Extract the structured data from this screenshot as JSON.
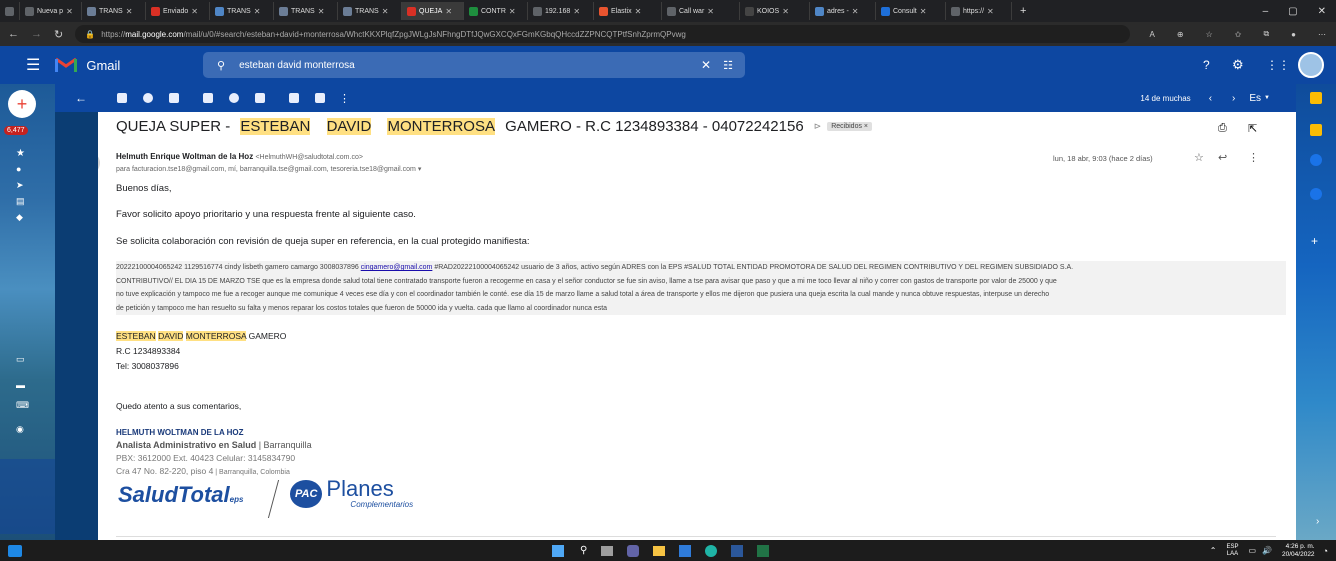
{
  "browser": {
    "tabs": [
      {
        "label": "Nueva p"
      },
      {
        "label": "TRANS"
      },
      {
        "label": "Enviado"
      },
      {
        "label": "TRANS"
      },
      {
        "label": "TRANS"
      },
      {
        "label": "TRANS"
      },
      {
        "label": "QUEJA"
      },
      {
        "label": "CONTR"
      },
      {
        "label": "192.168"
      },
      {
        "label": "Elastix"
      },
      {
        "label": "Call war"
      },
      {
        "label": "KOIOS"
      },
      {
        "label": "adres -"
      },
      {
        "label": "Consult"
      },
      {
        "label": "https://"
      }
    ],
    "url_prefix": "https://",
    "url_host": "mail.google.com",
    "url_rest": "/mail/u/0/#search/esteban+david+monterrosa/WhctKKXPlqfZpgJWLgJsNFhngDTfJQwGXCQxFGmKGbqQHccdZZPNCQTPtfSnhZprmQPvwg"
  },
  "gmail": {
    "brand": "Gmail",
    "search_value": "esteban david monterrosa",
    "unread_count": "6,477",
    "pager": "14 de muchas",
    "lang": "Es"
  },
  "email": {
    "subject_prefix": "QUEJA SUPER - ",
    "subject_name1": "ESTEBAN",
    "subject_name2": "DAVID",
    "subject_name3": "MONTERROSA",
    "subject_suffix": " GAMERO - R.C 1234893384 - 04072242156",
    "label": "Recibidos ×",
    "sender_name": "Helmuth Enrique Woltman de la Hoz",
    "sender_email": "<HelmuthWH@saludtotal.com.co>",
    "recipients": "para facturacion.tse18@gmail.com, mí, barranquilla.tse@gmail.com, tesoreria.tse18@gmail.com",
    "date": "lun, 18 abr, 9:03 (hace 2 días)",
    "greeting": "Buenos días,",
    "line1": "Favor solicito apoyo prioritario y una respuesta frente al siguiente caso.",
    "line2": "Se solicita colaboración con revisión de queja super en referencia, en la cual protegido manifiesta:",
    "quote1a": "20222100004065242 1129516774 cindy lisbeth gamero camargo 3008037896 ",
    "quote1_link": "cingamero@gmail.com",
    "quote1b": " #RAD20222100004065242 usuario de 3 años, activo según ADRES con la EPS #SALUD TOTAL ENTIDAD PROMOTORA DE SALUD DEL REGIMEN CONTRIBUTIVO Y DEL REGIMEN SUBSIDIADO S.A.",
    "quote2": "CONTRIBUTIVO// EL DIA 15 DE MARZO TSE que es la empresa donde salud total tiene contratado transporte fueron a recogerme en casa y el señor conductor se fue sin aviso, llame a tse para avisar que paso y que a mi me toco llevar al niño y correr con gastos de transporte por valor de 25000 y que",
    "quote3": "no tuve explicación y tampoco me fue a recoger aunque me comunique 4 veces ese día y con el coordinador también le conté. ese día 15 de marzo llame a salud total a área de transporte y ellos me dijeron que pusiera una queja escrita la cual mande y nunca obtuve respuestas, interpuse un derecho",
    "quote4": "de petición y tampoco me han resuelto su falta y menos reparar los costos totales que fueron de 50000 ida y vuelta. cada que llamo al coordinador nunca esta",
    "name_line_suffix": " GAMERO",
    "rc": "R.C 1234893384",
    "tel": "Tel: 3008037896",
    "closing": "Quedo atento a sus comentarios,",
    "sig_name": "HELMUTH WOLTMAN DE LA HOZ",
    "sig_title": "Analista Administrativo en Salud",
    "sig_city": " | Barranquilla",
    "sig_phone": "PBX: 3612000 Ext. 40423 Celular: 3145834790",
    "sig_addr": "Cra 47 No. 82-220, piso 4",
    "sig_addr_city": " | Barranquilla, Colombia",
    "logo1": "SaludTotal",
    "logo1_suffix": "eps",
    "logo2_badge": "PAC",
    "logo2": "Planes",
    "logo2_sub": "Complementarios"
  },
  "taskbar": {
    "lang_top": "ESP",
    "lang_bottom": "LAA",
    "time": "4:26 p. m.",
    "date": "20/04/2022"
  },
  "colors": {
    "gmail_blue": "#0d47a1",
    "highlight": "#ffe082",
    "signature_blue": "#1a3a7a"
  }
}
